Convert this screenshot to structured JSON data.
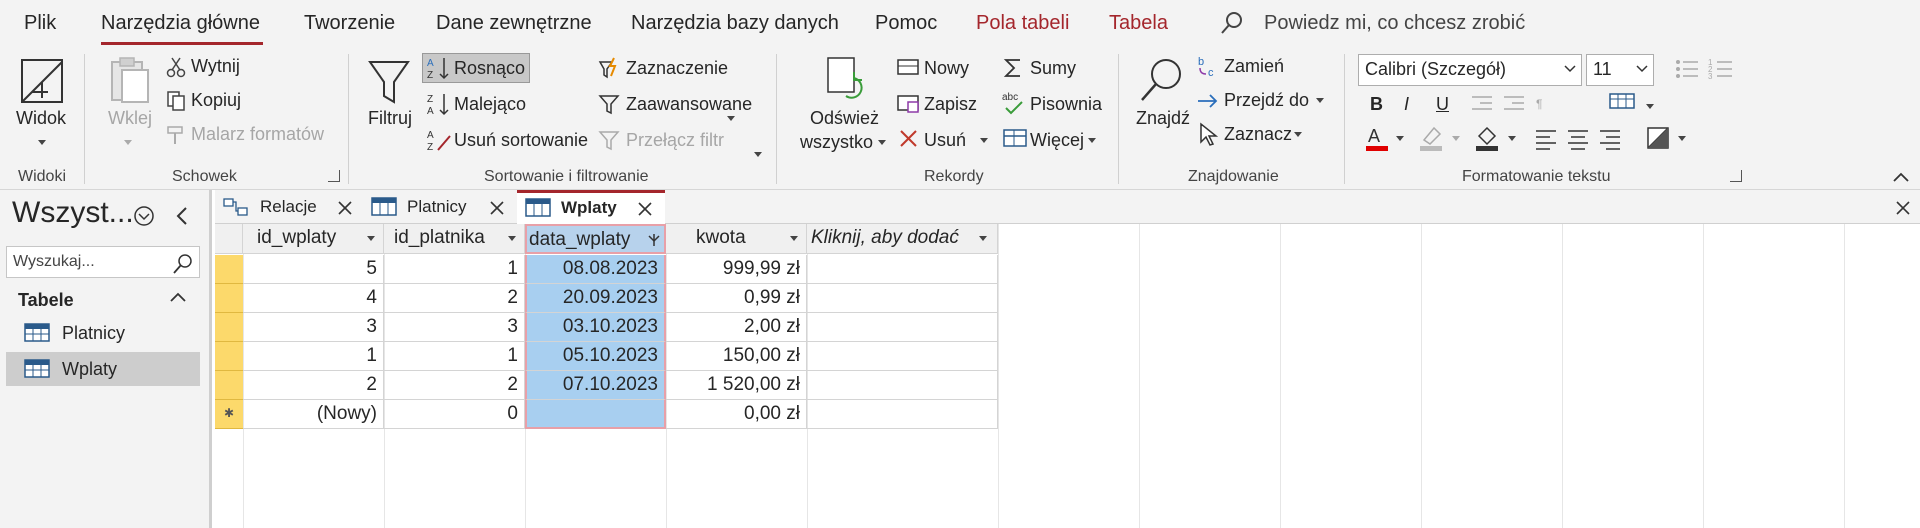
{
  "menu": {
    "tabs": [
      "Plik",
      "Narzędzia główne",
      "Tworzenie",
      "Dane zewnętrzne",
      "Narzędzia bazy danych",
      "Pomoc",
      "Pola tabeli",
      "Tabela"
    ],
    "tell_me": "Powiedz mi, co chcesz zrobić"
  },
  "ribbon": {
    "widoki": {
      "view": "Widok",
      "group": "Widoki"
    },
    "schowek": {
      "paste": "Wklej",
      "cut": "Wytnij",
      "copy": "Kopiuj",
      "format_painter": "Malarz formatów",
      "group": "Schowek"
    },
    "sort": {
      "filter": "Filtruj",
      "asc": "Rosnąco",
      "desc": "Malejąco",
      "remove": "Usuń sortowanie",
      "selection": "Zaznaczenie",
      "advanced": "Zaawansowane",
      "toggle": "Przełącz filtr",
      "group": "Sortowanie i filtrowanie"
    },
    "records": {
      "refresh_1": "Odśwież",
      "refresh_2": "wszystko",
      "new": "Nowy",
      "save": "Zapisz",
      "delete": "Usuń",
      "totals": "Sumy",
      "spelling": "Pisownia",
      "more": "Więcej",
      "group": "Rekordy"
    },
    "find": {
      "find": "Znajdź",
      "replace": "Zamień",
      "goto": "Przejdź do",
      "select": "Zaznacz",
      "group": "Znajdowanie"
    },
    "text": {
      "font": "Calibri (Szczegół)",
      "size": "11",
      "bold": "B",
      "italic": "I",
      "underline": "U",
      "group": "Formatowanie tekstu"
    }
  },
  "nav": {
    "title": "Wszyst...",
    "search_placeholder": "Wyszukaj...",
    "section": "Tabele",
    "items": [
      "Platnicy",
      "Wplaty"
    ]
  },
  "doc_tabs": [
    "Relacje",
    "Platnicy",
    "Wplaty"
  ],
  "table": {
    "columns": [
      "id_wplaty",
      "id_platnika",
      "data_wplaty",
      "kwota",
      "Kliknij, aby dodać"
    ],
    "rows": [
      [
        "5",
        "1",
        "08.08.2023",
        "999,99 zł"
      ],
      [
        "4",
        "2",
        "20.09.2023",
        "0,99 zł"
      ],
      [
        "3",
        "3",
        "03.10.2023",
        "2,00 zł"
      ],
      [
        "1",
        "1",
        "05.10.2023",
        "150,00 zł"
      ],
      [
        "2",
        "2",
        "07.10.2023",
        "1 520,00 zł"
      ]
    ],
    "new_row": [
      "(Nowy)",
      "0",
      "",
      "0,00 zł"
    ]
  },
  "colors": {
    "accent": "#a4262c",
    "selection": "#a8cff0",
    "row_selector": "#fcd96b"
  }
}
